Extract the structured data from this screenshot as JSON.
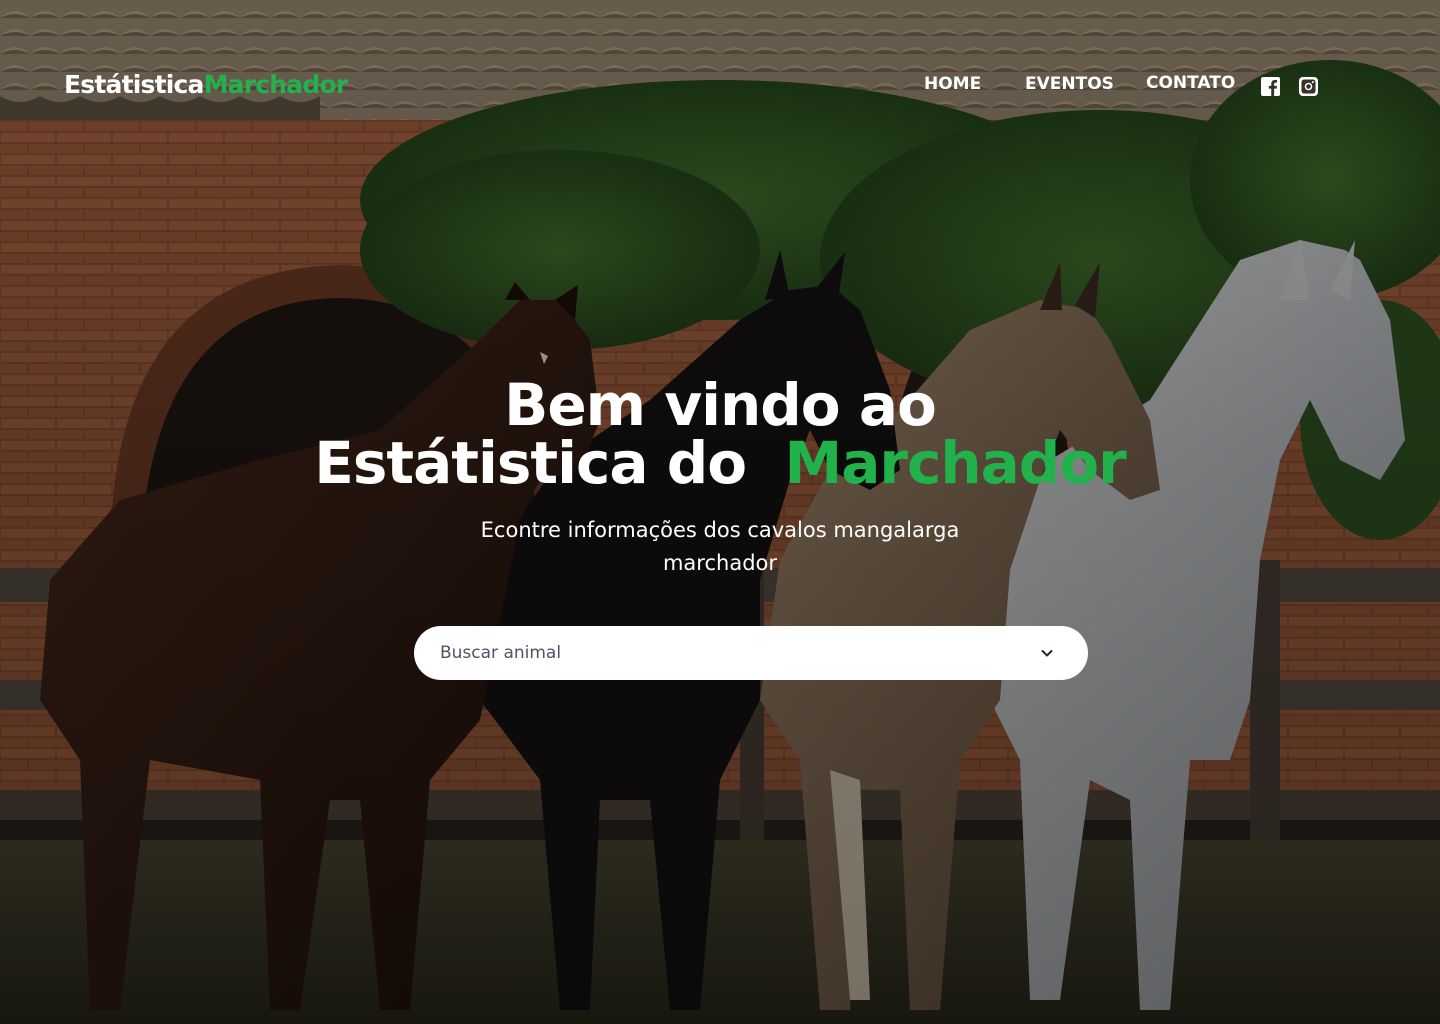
{
  "brand": {
    "name_main": "Estátistica",
    "name_accent": "Marchador",
    "accent_color": "#22b24c"
  },
  "nav": {
    "items": [
      {
        "label": "HOME"
      },
      {
        "label": "EVENTOS"
      },
      {
        "label": "CONTATO"
      }
    ],
    "social": [
      "facebook-icon",
      "instagram-icon"
    ]
  },
  "hero": {
    "title_line1": "Bem vindo ao",
    "title_line2_main": "Estátistica do ",
    "title_line2_accent": "Marchador",
    "subtitle": "Econtre  informações dos cavalos mangalarga marchador"
  },
  "search": {
    "placeholder": "Buscar animal",
    "value": ""
  }
}
